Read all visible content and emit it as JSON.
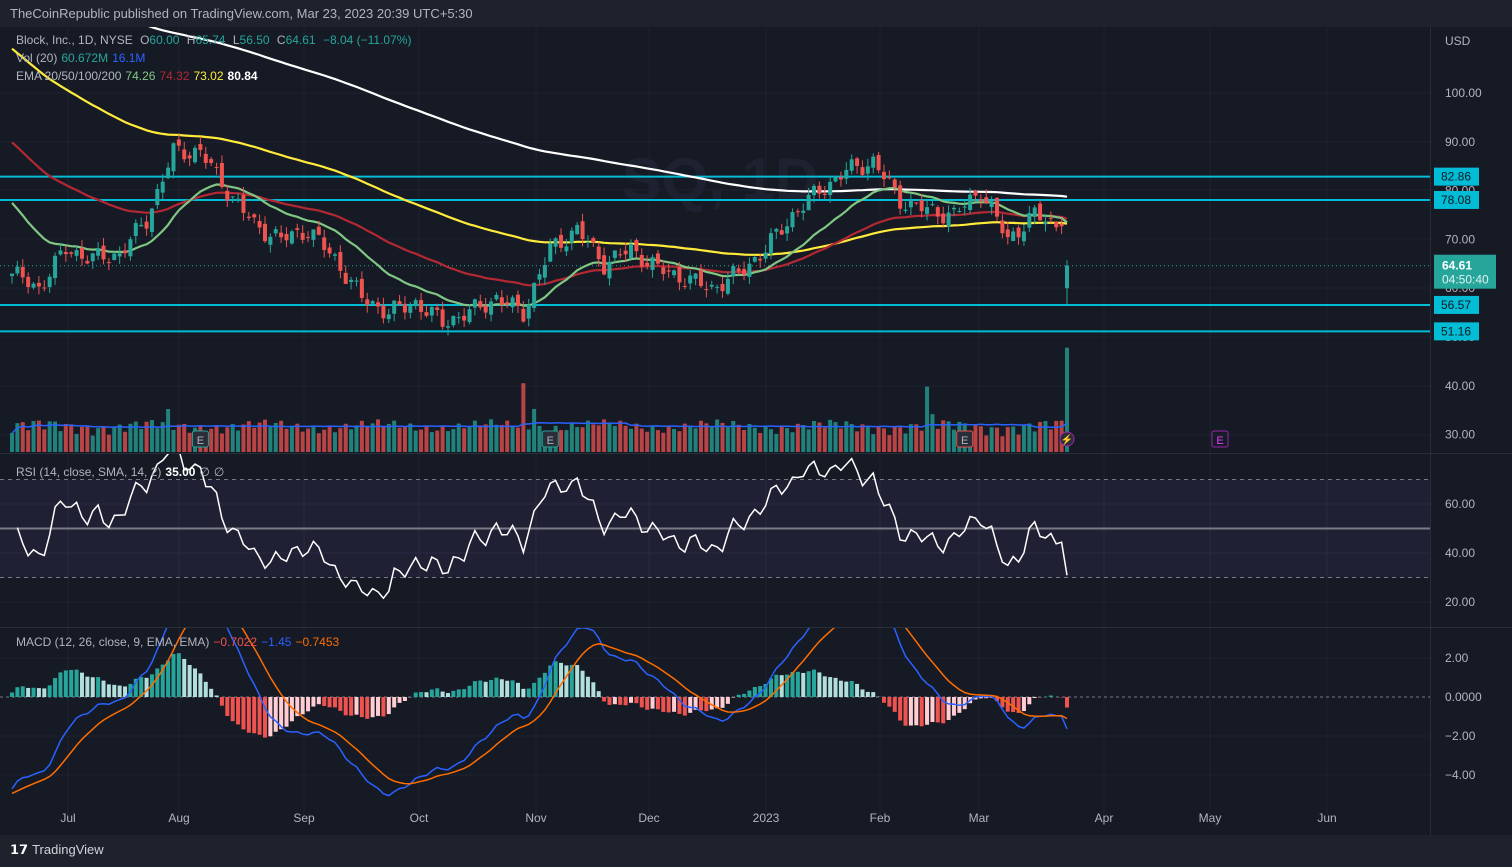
{
  "header": {
    "publisher": "TheCoinRepublic published on TradingView.com, Mar 23, 2023 20:39 UTC+5:30"
  },
  "legend": {
    "symbol": "Block, Inc., 1D, NYSE",
    "o_label": "O",
    "o": "60.00",
    "h_label": "H",
    "h": "65.74",
    "l_label": "L",
    "l": "56.50",
    "c_label": "C",
    "c": "64.61",
    "change": "−8.04 (−11.07%)",
    "vol_label": "Vol (20)",
    "vol": "60.672M",
    "vol_ma": "16.1M",
    "ema_label": "EMA 20/50/100/200",
    "ema20": "74.26",
    "ema50": "74.32",
    "ema100": "73.02",
    "ema200": "80.84",
    "rsi_label": "RSI (14, close, SMA, 14, 2)",
    "rsi": "35.00",
    "rsi_na1": "∅",
    "rsi_na2": "∅",
    "macd_label": "MACD (12, 26, close, 9, EMA, EMA)",
    "macd_hist": "−0.7022",
    "macd": "−1.45",
    "macd_signal": "−0.7453"
  },
  "price_axis": {
    "currency": "USD",
    "ticks": [
      "100.00",
      "90.00",
      "80.00",
      "70.00",
      "60.00",
      "50.00",
      "40.00",
      "30.00"
    ],
    "last_price": "64.61",
    "countdown": "04:50:40"
  },
  "rsi_axis": {
    "ticks": [
      "60.00",
      "40.00",
      "20.00"
    ]
  },
  "macd_axis": {
    "ticks": [
      "2.00",
      "0.0000",
      "−2.00",
      "−4.00"
    ]
  },
  "time_axis": [
    "Jul",
    "Aug",
    "Sep",
    "Oct",
    "Nov",
    "Dec",
    "2023",
    "Feb",
    "Mar",
    "Apr",
    "May",
    "Jun"
  ],
  "footer": {
    "brand": "TradingView"
  },
  "watermark": "SQ, 1D",
  "colors": {
    "up": "#26a69a",
    "down": "#ef5350",
    "level": "#00bcd4",
    "ema20": "#81c784",
    "ema50": "#b22833",
    "ema100": "#ffeb3b",
    "ema200": "#ffffff",
    "macd": "#2962ff",
    "signal": "#ff6d00",
    "vol_ma": "#2962ff"
  },
  "chart_data": {
    "type": "candlestick",
    "symbol": "SQ",
    "interval": "1D",
    "weekly_close_anchors": [
      63,
      60,
      68,
      66,
      67,
      74,
      88,
      88,
      80,
      73,
      70,
      72,
      66,
      58,
      55,
      57,
      53,
      55,
      58,
      55,
      68,
      72,
      65,
      68,
      64,
      62,
      60,
      63,
      68,
      75,
      80,
      84,
      86,
      78,
      76,
      75,
      80,
      70,
      75,
      72.7
    ],
    "last_candle": {
      "open": 60.0,
      "high": 65.74,
      "low": 56.5,
      "close": 64.61,
      "volume_m": 60.672
    },
    "ema_seeds": {
      "ema20": 79,
      "ema50": 91,
      "ema100": 110,
      "ema200": 128
    },
    "ema_last": {
      "ema20": 74.26,
      "ema50": 74.32,
      "ema100": 73.02,
      "ema200": 80.84
    },
    "horizontal_levels": [
      82.86,
      78.08,
      56.57,
      51.16
    ],
    "volume": {
      "baseline_m": 11,
      "ma20_m": 16.1,
      "spikes": [
        {
          "day": 29,
          "m": 25
        },
        {
          "day": 95,
          "m": 40
        },
        {
          "day": 97,
          "m": 25
        },
        {
          "day": 170,
          "m": 38
        },
        {
          "day": 171,
          "m": 22
        }
      ]
    },
    "earnings_days": [
      35,
      100,
      177,
      217
    ],
    "rsi": {
      "last": 35.0,
      "upper": 70,
      "middle": 50,
      "lower": 30,
      "range": [
        10,
        80
      ]
    },
    "macd": {
      "last": -1.45,
      "signal": -0.7453,
      "hist": -0.7022,
      "range": [
        -5,
        3
      ]
    },
    "price_range": [
      30,
      112
    ],
    "x_labels": [
      "Jul",
      "Aug",
      "Sep",
      "Oct",
      "Nov",
      "Dec",
      "2023",
      "Feb",
      "Mar",
      "Apr",
      "May",
      "Jun"
    ]
  }
}
